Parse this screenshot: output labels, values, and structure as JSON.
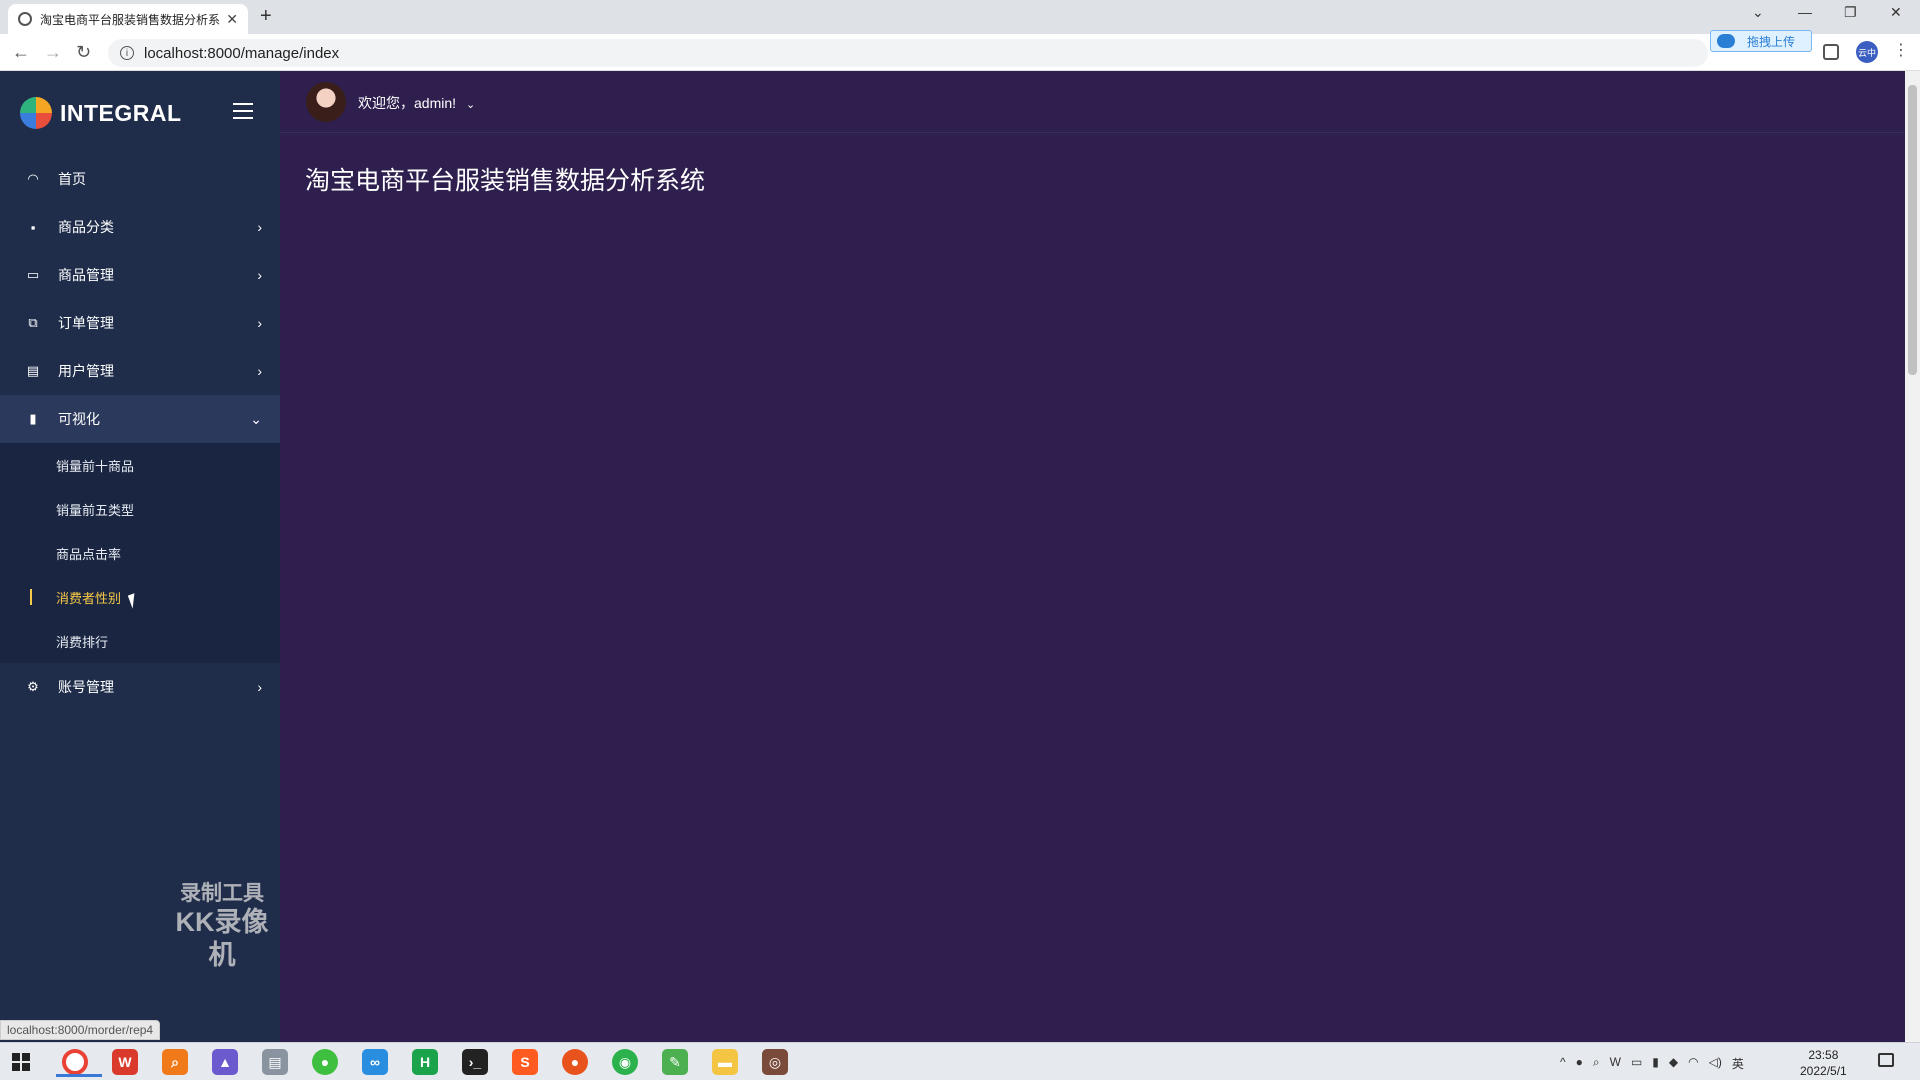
{
  "browser": {
    "tab_title": "淘宝电商平台服装销售数据分析系",
    "tab_close": "✕",
    "new_tab": "+",
    "url": "localhost:8000/manage/index",
    "upload_label": "拖拽上传",
    "profile_label": "云中",
    "status_url": "localhost:8000/morder/rep4"
  },
  "sidebar": {
    "logo_text": "INTEGRAL",
    "items": [
      {
        "label": "首页",
        "icon": "dashboard-icon"
      },
      {
        "label": "商品分类",
        "icon": "grid-icon"
      },
      {
        "label": "商品管理",
        "icon": "window-icon"
      },
      {
        "label": "订单管理",
        "icon": "copy-icon"
      },
      {
        "label": "用户管理",
        "icon": "list-icon"
      },
      {
        "label": "可视化",
        "icon": "bar-chart-icon"
      },
      {
        "label": "账号管理",
        "icon": "gears-icon"
      }
    ],
    "submenu": [
      {
        "label": "销量前十商品"
      },
      {
        "label": "销量前五类型"
      },
      {
        "label": "商品点击率"
      },
      {
        "label": "消费者性别"
      },
      {
        "label": "消费排行"
      }
    ],
    "watermark_line1": "录制工具",
    "watermark_line2": "KK录像机"
  },
  "header": {
    "welcome": "欢迎您，admin!"
  },
  "main": {
    "title": "淘宝电商平台服装销售数据分析系统"
  },
  "taskbar": {
    "time": "23:58",
    "date": "2022/5/1",
    "ime": "英"
  },
  "colors": {
    "sidebar_bg": "#1f2d4b",
    "main_bg": "#2e1f4e",
    "highlight": "#f7c948"
  }
}
